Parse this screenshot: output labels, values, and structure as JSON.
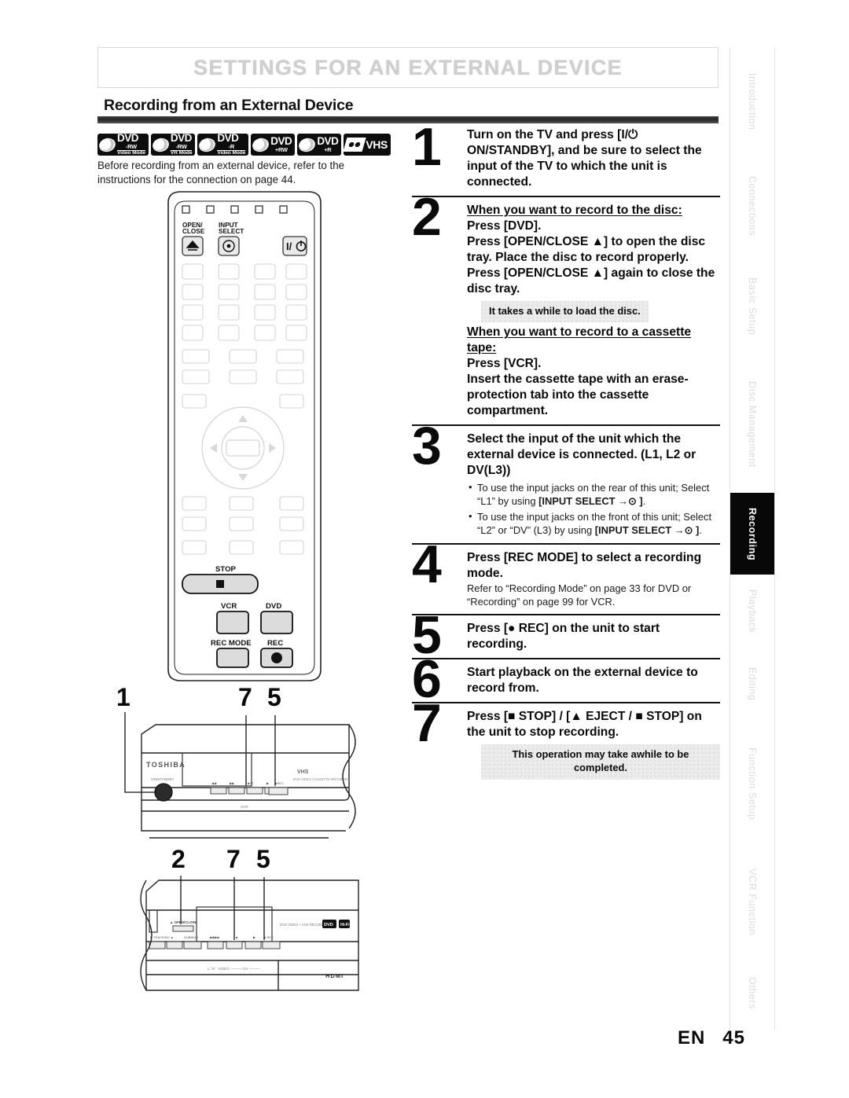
{
  "banner": {
    "title": "SETTINGS FOR AN EXTERNAL DEVICE"
  },
  "section": {
    "title": "Recording from an External Device"
  },
  "media_badges": [
    {
      "name": "dvd-rw-video-mode",
      "kind": "disc",
      "line1": "DVD",
      "line2": "-RW",
      "line3": "Video Mode"
    },
    {
      "name": "dvd-rw-vr-mode",
      "kind": "disc",
      "line1": "DVD",
      "line2": "-RW",
      "line3": "VR Mode"
    },
    {
      "name": "dvd-r-video-mode",
      "kind": "disc",
      "line1": "DVD",
      "line2": "-R",
      "line3": "Video Mode"
    },
    {
      "name": "dvd-plus-rw",
      "kind": "disc",
      "line1": "DVD",
      "line2": "+RW",
      "line3": ""
    },
    {
      "name": "dvd-plus-r",
      "kind": "disc",
      "line1": "DVD",
      "line2": "+R",
      "line3": ""
    },
    {
      "name": "vhs",
      "kind": "tape",
      "line1": "VHS",
      "line2": "",
      "line3": ""
    }
  ],
  "intro": "Before recording from an external device, refer to the instructions for the connection on page 44.",
  "steps": [
    {
      "number": "1",
      "bold": "Turn on the TV and press [I/⏻ ON/STANDBY], and be sure to select the input of the TV to which the unit is connected."
    },
    {
      "number": "2",
      "underline_1": "When you want to record to the disc:",
      "bold_1": "Press [DVD].",
      "bold_2": "Press [OPEN/CLOSE ▲] to open the disc tray. Place the disc to record properly.",
      "bold_3": "Press [OPEN/CLOSE ▲] again to close the disc tray.",
      "note": "It takes a while to load the disc.",
      "underline_2": "When you want to record to a cassette tape:",
      "bold_4": "Press [VCR].",
      "bold_5": "Insert the cassette tape with an erase-protection tab into the cassette compartment."
    },
    {
      "number": "3",
      "bold": "Select the input of the unit which the external device is connected. (L1, L2 or DV(L3))",
      "bullet_1_a": "To use the input jacks on the rear of this unit; Select “L1” by using ",
      "bullet_1_b": "[INPUT SELECT →⊙ ]",
      "bullet_1_c": ".",
      "bullet_2_a": "To use the input jacks on the front of this unit; Select “L2” or “DV” (L3) by using ",
      "bullet_2_b": "[INPUT SELECT →⊙ ]",
      "bullet_2_c": "."
    },
    {
      "number": "4",
      "bold": "Press [REC MODE] to select a recording mode.",
      "normal": "Refer to “Recording Mode” on page 33 for DVD or “Recording” on page 99 for VCR."
    },
    {
      "number": "5",
      "bold": "Press [● REC] on the unit to start recording."
    },
    {
      "number": "6",
      "bold": "Start playback on the external device to record from."
    },
    {
      "number": "7",
      "bold": "Press [■ STOP] / [▲ EJECT / ■ STOP] on the unit to stop recording.",
      "note": "This operation may take awhile to be completed."
    }
  ],
  "remote": {
    "labels": {
      "open_close": "OPEN/ CLOSE",
      "input_select": "INPUT SELECT",
      "power": "I/⏻",
      "stop": "STOP",
      "vcr": "VCR",
      "dvd": "DVD",
      "rec_mode": "REC MODE",
      "rec": "REC"
    }
  },
  "device_front_top": {
    "callouts": [
      "1",
      "7",
      "5"
    ],
    "brand": "TOSHIBA",
    "sublabel": "DVD VIDEO CASSETTE RECORDER"
  },
  "device_front_bottom": {
    "callouts": [
      "2",
      "7",
      "5"
    ],
    "open_close_label": "OPEN/CLOSE",
    "sublabel": "DVD VIDEO + VHS RECORDING",
    "hdmi": "HDMI"
  },
  "side_tabs": [
    {
      "label": "Introduction",
      "active": false
    },
    {
      "label": "Connections",
      "active": false
    },
    {
      "label": "Basic Setup",
      "active": false
    },
    {
      "label": "Disc Management",
      "active": false
    },
    {
      "label": "Recording",
      "active": true
    },
    {
      "label": "Playback",
      "active": false
    },
    {
      "label": "Editing",
      "active": false
    },
    {
      "label": "Function Setup",
      "active": false
    },
    {
      "label": "VCR Function",
      "active": false
    },
    {
      "label": "Others",
      "active": false
    }
  ],
  "footer": {
    "lang": "EN",
    "page": "45"
  }
}
